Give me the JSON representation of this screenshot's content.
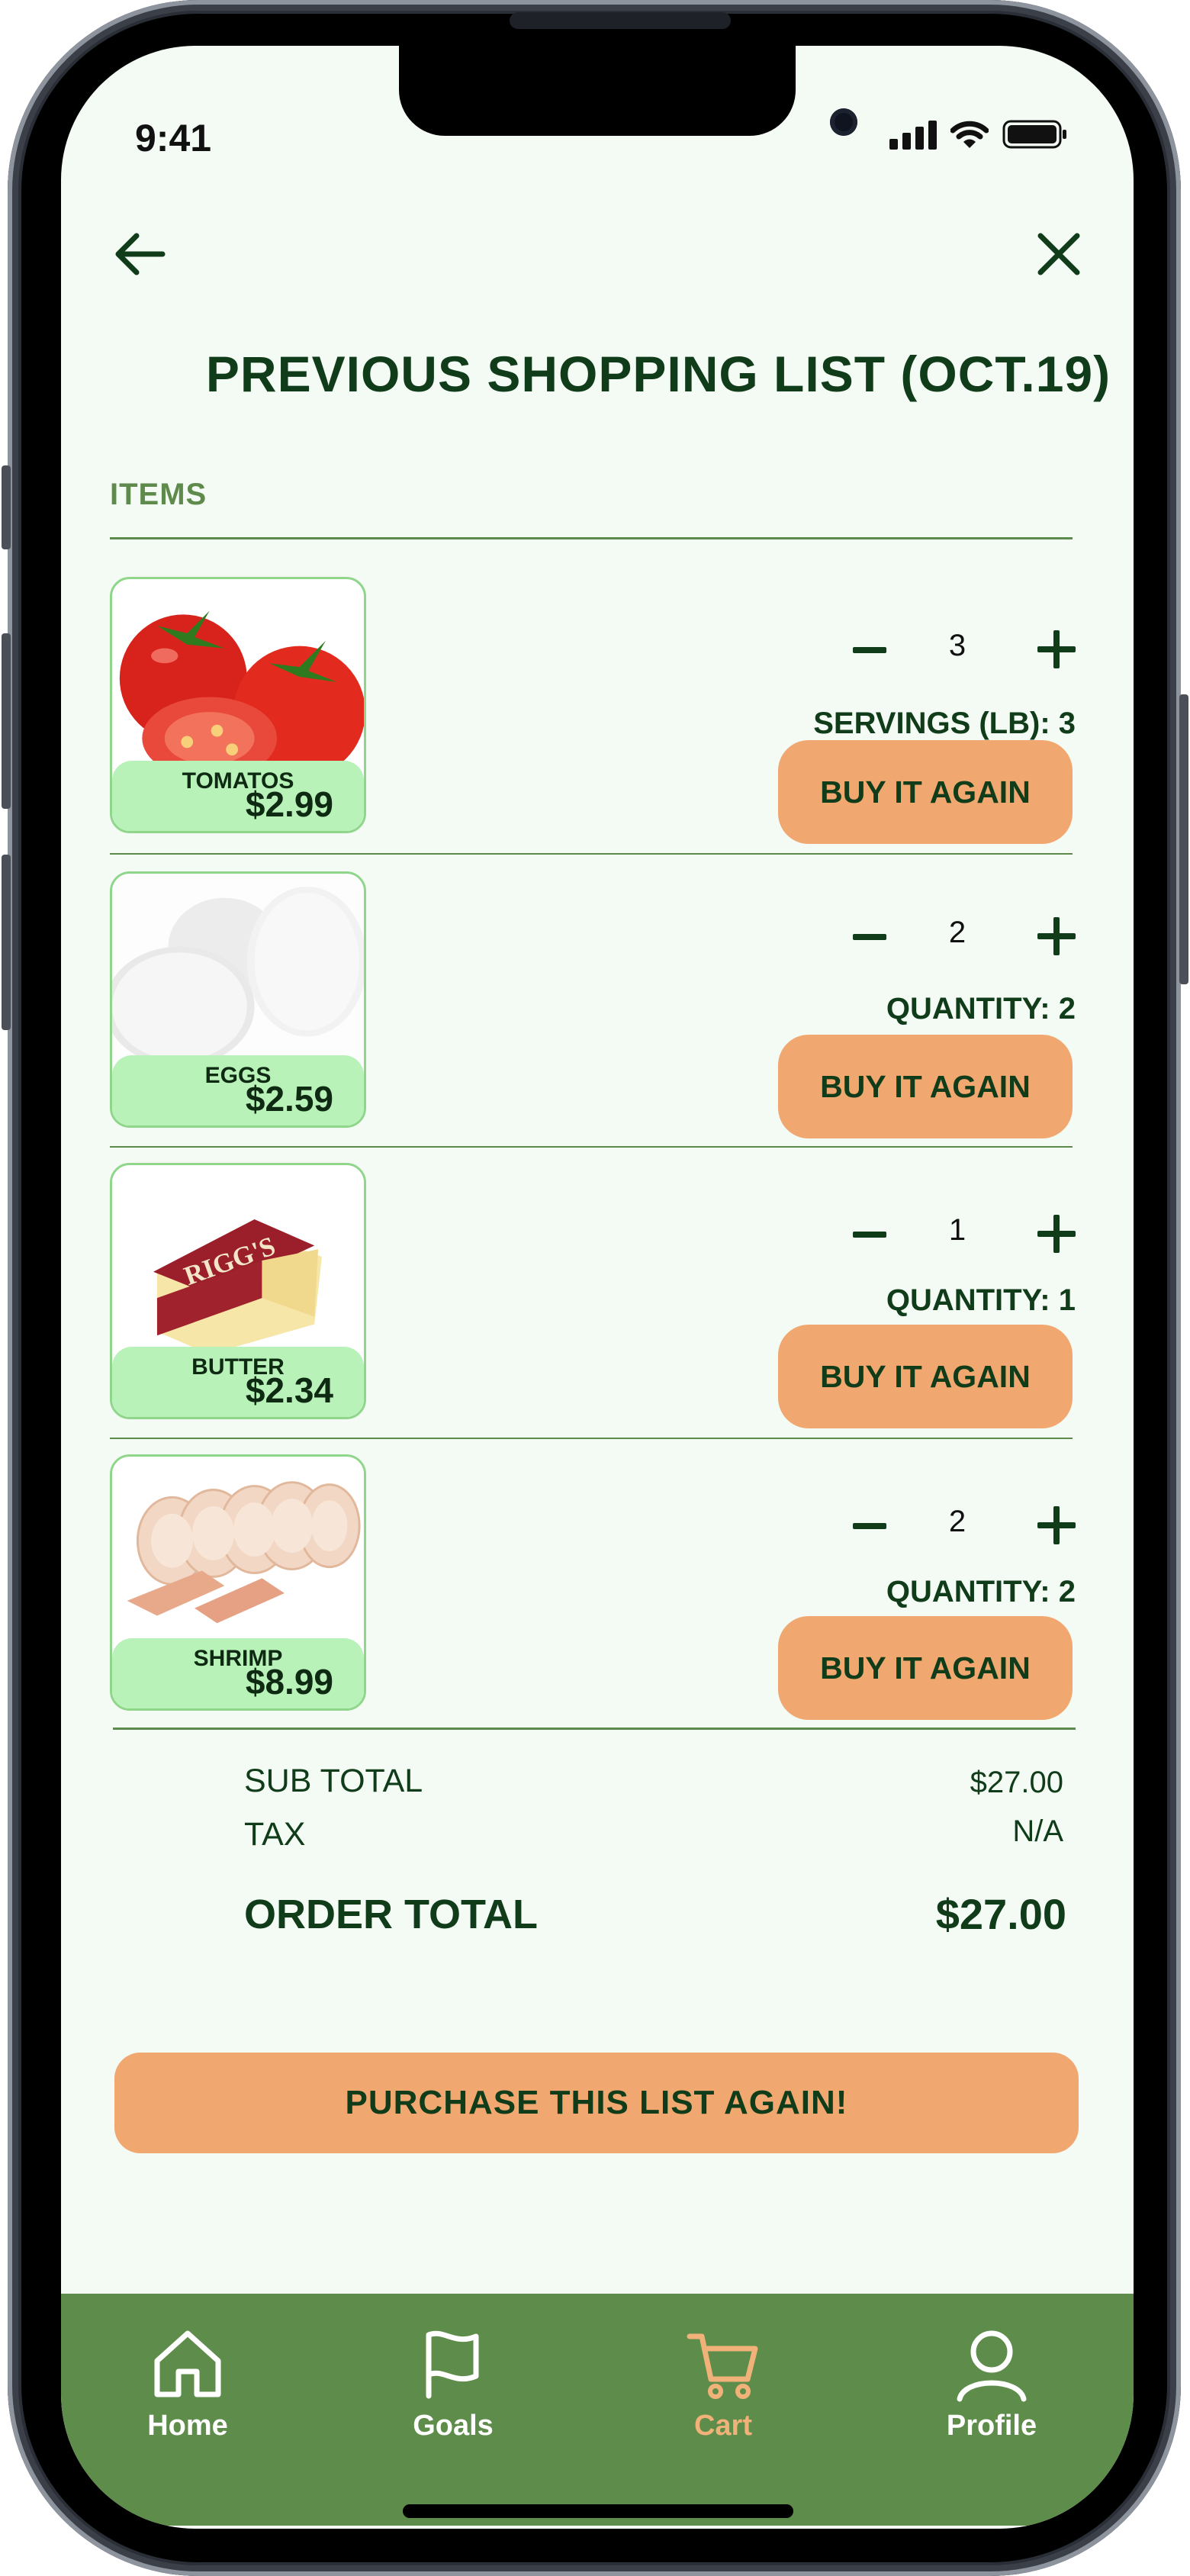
{
  "status_bar": {
    "time": "9:41"
  },
  "header": {
    "title": "PREVIOUS SHOPPING LIST (OCT.19)"
  },
  "section": {
    "label": "ITEMS"
  },
  "items": [
    {
      "name": "TOMATOS",
      "price": "$2.99",
      "count": "3",
      "qty_label": "SERVINGS (LB): 3",
      "button": "BUY IT AGAIN"
    },
    {
      "name": "EGGS",
      "price": "$2.59",
      "count": "2",
      "qty_label": "QUANTITY: 2",
      "button": "BUY IT AGAIN"
    },
    {
      "name": "BUTTER",
      "price": "$2.34",
      "count": "1",
      "qty_label": "QUANTITY: 1",
      "button": "BUY IT AGAIN"
    },
    {
      "name": "SHRIMP",
      "price": "$8.99",
      "count": "2",
      "qty_label": "QUANTITY: 2",
      "button": "BUY IT AGAIN"
    }
  ],
  "totals": {
    "subtotal_label": "SUB TOTAL",
    "subtotal_value": "$27.00",
    "tax_label": "TAX",
    "tax_value": "N/A",
    "order_label": "ORDER TOTAL",
    "order_value": "$27.00"
  },
  "purchase_button": "PURCHASE THIS LIST AGAIN!",
  "butter_package_text": "RIGG'S",
  "tabs": [
    {
      "label": "Home",
      "icon": "home-icon",
      "active": false
    },
    {
      "label": "Goals",
      "icon": "flag-icon",
      "active": false
    },
    {
      "label": "Cart",
      "icon": "cart-icon",
      "active": true
    },
    {
      "label": "Profile",
      "icon": "profile-icon",
      "active": false
    }
  ],
  "colors": {
    "background": "#f3fbf4",
    "primary_text": "#103c1a",
    "accent_orange": "#f1a870",
    "tab_bar_green": "#5e8c4a",
    "thumb_label_green": "#b8f2b9",
    "active_tab": "#f1b27a"
  }
}
